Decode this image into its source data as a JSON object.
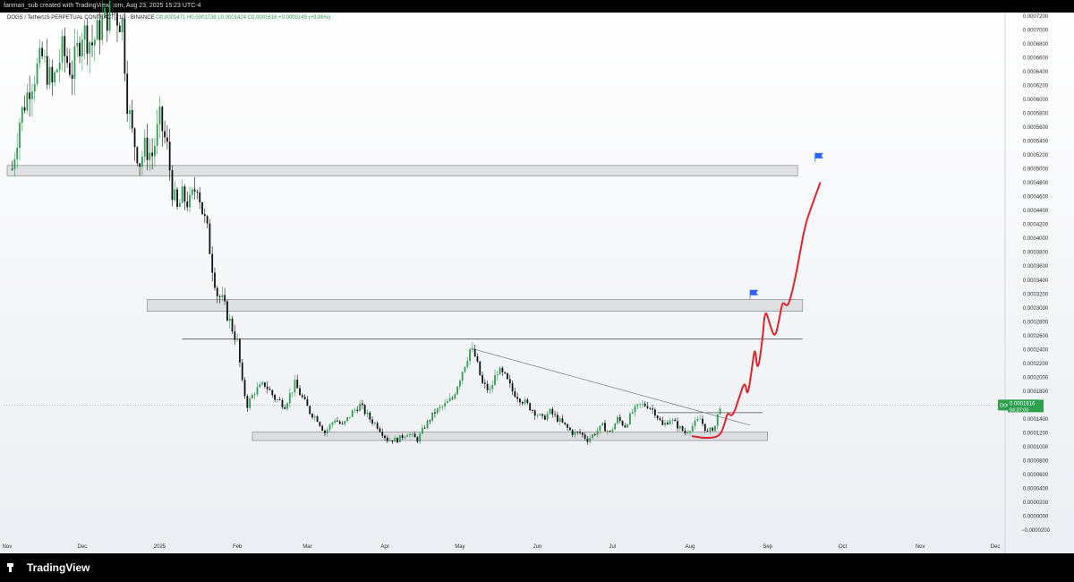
{
  "header": {
    "created_by": "fanman_sub created with TradingView.com, Aug 23, 2025 15:23 UTC-4"
  },
  "legend": {
    "symbol": "DOGS / TetherUS PERPETUAL CONTRACT · 1D · BINANCE",
    "open": "O0.0001471",
    "high": "H0.0001738",
    "low": "L0.0001424",
    "close": "C0.0001616",
    "change": "+0.0000145 (+9.86%)"
  },
  "price_tag": {
    "symbol": "DOGSUSDT.P",
    "price": "0.0001616",
    "countdown": "04:37:00"
  },
  "footer": {
    "brand": "TradingView"
  },
  "colors": {
    "up": "#2e9e4f",
    "down": "#111111",
    "annotation": "#e0242c",
    "flag": "#2962ff",
    "tag": "#2e9e4f"
  },
  "chart_data": {
    "type": "candlestick",
    "y_axis_labels": [
      "0.0007200",
      "0.0007000",
      "0.0006800",
      "0.0006600",
      "0.0006400",
      "0.0006200",
      "0.0006000",
      "0.0005800",
      "0.0005600",
      "0.0005400",
      "0.0005200",
      "0.0005000",
      "0.0004800",
      "0.0004600",
      "0.0004400",
      "0.0004200",
      "0.0004000",
      "0.0003800",
      "0.0003600",
      "0.0003400",
      "0.0003200",
      "0.0003000",
      "0.0002800",
      "0.0002600",
      "0.0002400",
      "0.0002200",
      "0.0002000",
      "0.0001800",
      "0.0001400",
      "0.0001200",
      "0.0001000",
      "0.0000800",
      "0.0000600",
      "0.0000400",
      "0.0000200",
      "0.0000000",
      "−0.0000200"
    ],
    "ylim": [
      -2e-05,
      0.00072
    ],
    "x_axis_labels": [
      {
        "label": "Nov",
        "day": 0
      },
      {
        "label": "Dec",
        "day": 30
      },
      {
        "label": "2025",
        "day": 61
      },
      {
        "label": "Feb",
        "day": 92
      },
      {
        "label": "Mar",
        "day": 120
      },
      {
        "label": "Apr",
        "day": 151
      },
      {
        "label": "May",
        "day": 181
      },
      {
        "label": "Jun",
        "day": 212
      },
      {
        "label": "Jul",
        "day": 242
      },
      {
        "label": "Aug",
        "day": 273
      },
      {
        "label": "Sep",
        "day": 304
      },
      {
        "label": "Oct",
        "day": 334
      },
      {
        "label": "Nov",
        "day": 365
      },
      {
        "label": "Dec",
        "day": 395
      }
    ],
    "price_path": [
      [
        2,
        0.0005
      ],
      [
        5,
        0.00057
      ],
      [
        9,
        0.00062
      ],
      [
        14,
        0.00066
      ],
      [
        18,
        0.00062
      ],
      [
        22,
        0.00067
      ],
      [
        26,
        0.00064
      ],
      [
        30,
        0.0007
      ],
      [
        34,
        0.00068
      ],
      [
        38,
        0.00071
      ],
      [
        42,
        0.00073
      ],
      [
        46,
        0.00071
      ],
      [
        48,
        0.0006
      ],
      [
        50,
        0.00055
      ],
      [
        53,
        0.00051
      ],
      [
        55,
        0.00053
      ],
      [
        58,
        0.00052
      ],
      [
        61,
        0.00057
      ],
      [
        64,
        0.00053
      ],
      [
        66,
        0.00047
      ],
      [
        68,
        0.00044
      ],
      [
        70,
        0.00046
      ],
      [
        73,
        0.00045
      ],
      [
        76,
        0.00048
      ],
      [
        78,
        0.00044
      ],
      [
        80,
        0.00041
      ],
      [
        82,
        0.00036
      ],
      [
        84,
        0.00032
      ],
      [
        86,
        0.00031
      ],
      [
        88,
        0.00029
      ],
      [
        90,
        0.00027
      ],
      [
        92,
        0.00025
      ],
      [
        94,
        0.00019
      ],
      [
        96,
        0.00016
      ],
      [
        99,
        0.00018
      ],
      [
        103,
        0.00019
      ],
      [
        107,
        0.00017
      ],
      [
        111,
        0.00016
      ],
      [
        115,
        0.00019
      ],
      [
        118,
        0.00017
      ],
      [
        121,
        0.00015
      ],
      [
        124,
        0.00014
      ],
      [
        127,
        0.00012
      ],
      [
        131,
        0.00014
      ],
      [
        134,
        0.00013
      ],
      [
        138,
        0.00015
      ],
      [
        141,
        0.00016
      ],
      [
        145,
        0.00014
      ],
      [
        148,
        0.00013
      ],
      [
        152,
        0.00011
      ],
      [
        156,
        0.00011
      ],
      [
        160,
        0.00012
      ],
      [
        164,
        0.00011
      ],
      [
        167,
        0.00013
      ],
      [
        171,
        0.00015
      ],
      [
        175,
        0.00016
      ],
      [
        178,
        0.00017
      ],
      [
        182,
        0.00021
      ],
      [
        185,
        0.00024
      ],
      [
        187,
        0.00023
      ],
      [
        190,
        0.00019
      ],
      [
        193,
        0.00018
      ],
      [
        196,
        0.00021
      ],
      [
        199,
        0.0002
      ],
      [
        202,
        0.00018
      ],
      [
        205,
        0.00017
      ],
      [
        208,
        0.00016
      ],
      [
        211,
        0.00015
      ],
      [
        214,
        0.00014
      ],
      [
        217,
        0.00015
      ],
      [
        220,
        0.00014
      ],
      [
        223,
        0.00013
      ],
      [
        226,
        0.00012
      ],
      [
        229,
        0.00012
      ],
      [
        232,
        0.00011
      ],
      [
        235,
        0.00012
      ],
      [
        238,
        0.00013
      ],
      [
        241,
        0.00012
      ],
      [
        244,
        0.00014
      ],
      [
        247,
        0.00013
      ],
      [
        250,
        0.00015
      ],
      [
        253,
        0.00016
      ],
      [
        256,
        0.00016
      ],
      [
        259,
        0.00015
      ],
      [
        262,
        0.00013
      ],
      [
        265,
        0.00014
      ],
      [
        268,
        0.00013
      ],
      [
        271,
        0.00012
      ],
      [
        274,
        0.00013
      ],
      [
        277,
        0.00014
      ],
      [
        280,
        0.00012
      ],
      [
        283,
        0.00013
      ],
      [
        285,
        0.00016
      ]
    ],
    "zones": [
      {
        "from": 0.00049,
        "to": 0.000505,
        "x0": 0,
        "x1": 316
      },
      {
        "from": 0.000295,
        "to": 0.000312,
        "x0": 56,
        "x1": 318
      },
      {
        "from": 0.000109,
        "to": 0.000121,
        "x0": 98,
        "x1": 304
      }
    ],
    "levels": [
      {
        "price": 0.000255,
        "x0": 70,
        "x1": 318
      },
      {
        "price": 0.000149,
        "x0": 260,
        "x1": 302
      }
    ],
    "trendline": [
      [
        185,
        0.000242
      ],
      [
        297,
        0.000131
      ]
    ],
    "projection": [
      [
        274,
        0.000115
      ],
      [
        280,
        0.000112
      ],
      [
        285,
        0.000115
      ],
      [
        287,
        0.000135
      ],
      [
        288,
        0.00015
      ],
      [
        290,
        0.000142
      ],
      [
        293,
        0.000175
      ],
      [
        295,
        0.000195
      ],
      [
        296,
        0.00017
      ],
      [
        298,
        0.00022
      ],
      [
        299,
        0.000245
      ],
      [
        300,
        0.000205
      ],
      [
        302,
        0.000255
      ],
      [
        303,
        0.0003
      ],
      [
        305,
        0.000275
      ],
      [
        307,
        0.000255
      ],
      [
        309,
        0.00029
      ],
      [
        310,
        0.00031
      ],
      [
        312,
        0.0003
      ],
      [
        314,
        0.000325
      ],
      [
        316,
        0.00036
      ],
      [
        319,
        0.00042
      ],
      [
        322,
        0.00045
      ],
      [
        325,
        0.00048
      ]
    ],
    "flags": [
      {
        "day": 297,
        "price": 0.000313
      },
      {
        "day": 323,
        "price": 0.00051
      }
    ]
  }
}
